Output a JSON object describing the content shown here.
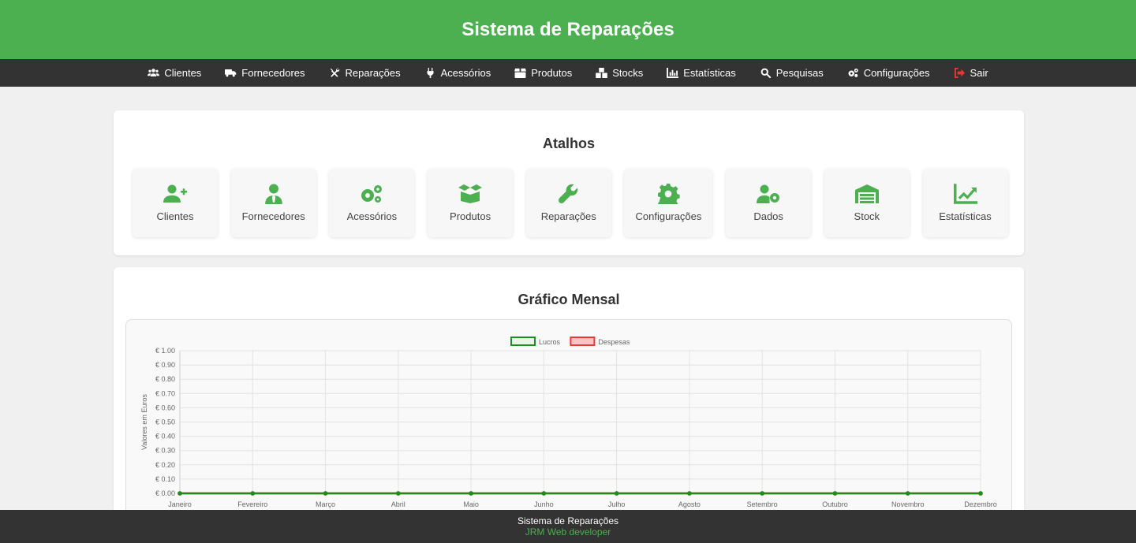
{
  "header": {
    "title": "Sistema de Reparações"
  },
  "nav": {
    "items": [
      {
        "label": "Clientes",
        "icon": "users-icon"
      },
      {
        "label": "Fornecedores",
        "icon": "truck-icon"
      },
      {
        "label": "Reparações",
        "icon": "tools-icon"
      },
      {
        "label": "Acessórios",
        "icon": "plug-icon"
      },
      {
        "label": "Produtos",
        "icon": "box-icon"
      },
      {
        "label": "Stocks",
        "icon": "boxes-icon"
      },
      {
        "label": "Estatísticas",
        "icon": "chart-icon"
      },
      {
        "label": "Pesquisas",
        "icon": "search-icon"
      },
      {
        "label": "Configurações",
        "icon": "cogs-icon"
      },
      {
        "label": "Sair",
        "icon": "sign-out-icon",
        "color": "#e53935"
      }
    ]
  },
  "shortcuts": {
    "title": "Atalhos",
    "items": [
      {
        "label": "Clientes",
        "icon": "user-plus-icon"
      },
      {
        "label": "Fornecedores",
        "icon": "user-tie-icon"
      },
      {
        "label": "Acessórios",
        "icon": "cogs-icon"
      },
      {
        "label": "Produtos",
        "icon": "box-open-icon"
      },
      {
        "label": "Reparações",
        "icon": "wrench-icon"
      },
      {
        "label": "Configurações",
        "icon": "gear-icon"
      },
      {
        "label": "Dados",
        "icon": "user-cog-icon"
      },
      {
        "label": "Stock",
        "icon": "warehouse-icon"
      },
      {
        "label": "Estatísticas",
        "icon": "chart-line-icon"
      }
    ]
  },
  "monthly_chart": {
    "title": "Gráfico Mensal"
  },
  "chart_data": {
    "type": "line",
    "categories": [
      "Janeiro",
      "Fevereiro",
      "Março",
      "Abril",
      "Maio",
      "Junho",
      "Julho",
      "Agosto",
      "Setembro",
      "Outubro",
      "Novembro",
      "Dezembro"
    ],
    "series": [
      {
        "name": "Lucros",
        "values": [
          0,
          0,
          0,
          0,
          0,
          0,
          0,
          0,
          0,
          0,
          0,
          0
        ],
        "color": "#1e8c1e",
        "fill": "#e8f5e8"
      },
      {
        "name": "Despesas",
        "values": [
          0,
          0,
          0,
          0,
          0,
          0,
          0,
          0,
          0,
          0,
          0,
          0
        ],
        "color": "#e53935",
        "fill": "#f6c6c6"
      }
    ],
    "ylabel": "Valores em Euros",
    "ylim": [
      0,
      1
    ],
    "yticks": [
      "€ 1.00",
      "€ 0.90",
      "€ 0.80",
      "€ 0.70",
      "€ 0.60",
      "€ 0.50",
      "€ 0.40",
      "€ 0.30",
      "€ 0.20",
      "€ 0.10",
      "€ 0.00"
    ],
    "grid": true,
    "legend": "top-center"
  },
  "footer": {
    "line1": "Sistema de Reparações",
    "line2": "JRM Web developer"
  },
  "colors": {
    "accent": "#4caf50",
    "nav_bg": "#333333",
    "exit": "#e53935"
  }
}
